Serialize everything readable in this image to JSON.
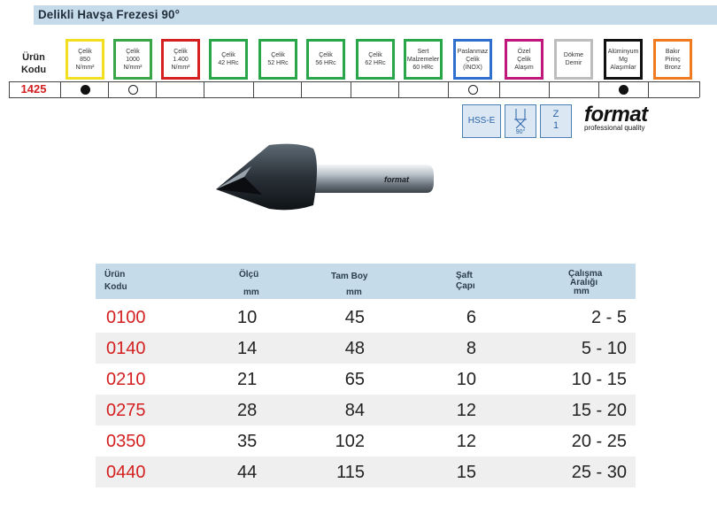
{
  "title": "Delikli Havşa Frezesi 90°",
  "grid": {
    "header_line1": "Ürün",
    "header_line2": "Kodu",
    "product_code": "1425",
    "materials": [
      {
        "label": "Çelik\n850\nN/mm²",
        "color": "#f2e020",
        "mark": "filled"
      },
      {
        "label": "Çelik\n1000\nN/mm²",
        "color": "#3aa64a",
        "mark": "hollow"
      },
      {
        "label": "Çelik\n1.400\nN/mm²",
        "color": "#d42020",
        "mark": ""
      },
      {
        "label": "Çelik\n42 HRc",
        "color": "#2aa64a",
        "mark": ""
      },
      {
        "label": "Çelik\n52 HRc",
        "color": "#2aa64a",
        "mark": ""
      },
      {
        "label": "Çelik\n56 HRc",
        "color": "#2aa64a",
        "mark": ""
      },
      {
        "label": "Çelik\n62 HRc",
        "color": "#2aa64a",
        "mark": ""
      },
      {
        "label": "Sert\nMalzemeler\n60 HRc",
        "color": "#2aa64a",
        "mark": ""
      },
      {
        "label": "Paslanmaz\nÇelik\n(İNOX)",
        "color": "#2f6fd0",
        "mark": "hollow"
      },
      {
        "label": "Özel\nÇelik\nAlaşım",
        "color": "#c0187a",
        "mark": ""
      },
      {
        "label": "Dökme\nDemir",
        "color": "#bdbdbd",
        "mark": ""
      },
      {
        "label": "Alüminyum\nMg\nAlaşımlar",
        "color": "#111111",
        "mark": "filled"
      },
      {
        "label": "Bakır\nPirinç\nBronz",
        "color": "#f07a20",
        "mark": ""
      }
    ]
  },
  "badges": {
    "hss": "HSS-E",
    "angle": "90°",
    "z_label": "Z",
    "z_value": "1"
  },
  "logo": {
    "word": "format",
    "tagline": "professional quality",
    "tool_text": "format"
  },
  "table": {
    "headers": {
      "code_1": "Ürün",
      "code_2": "Kodu",
      "size_1": "Ölçü",
      "size_2": "mm",
      "len_1": "Tam Boy",
      "len_2": "mm",
      "shaft_1": "Şaft",
      "shaft_2": "Çapı",
      "range_1": "Çalışma",
      "range_2": "Aralığı",
      "range_3": "mm"
    },
    "rows": [
      {
        "code": "0100",
        "size": "10",
        "length": "45",
        "shaft": "6",
        "range": "2 -  5"
      },
      {
        "code": "0140",
        "size": "14",
        "length": "48",
        "shaft": "8",
        "range": "5 - 10"
      },
      {
        "code": "0210",
        "size": "21",
        "length": "65",
        "shaft": "10",
        "range": "10 - 15"
      },
      {
        "code": "0275",
        "size": "28",
        "length": "84",
        "shaft": "12",
        "range": "15 - 20"
      },
      {
        "code": "0350",
        "size": "35",
        "length": "102",
        "shaft": "12",
        "range": "20 - 25"
      },
      {
        "code": "0440",
        "size": "44",
        "length": "115",
        "shaft": "15",
        "range": "25 - 30"
      }
    ]
  }
}
